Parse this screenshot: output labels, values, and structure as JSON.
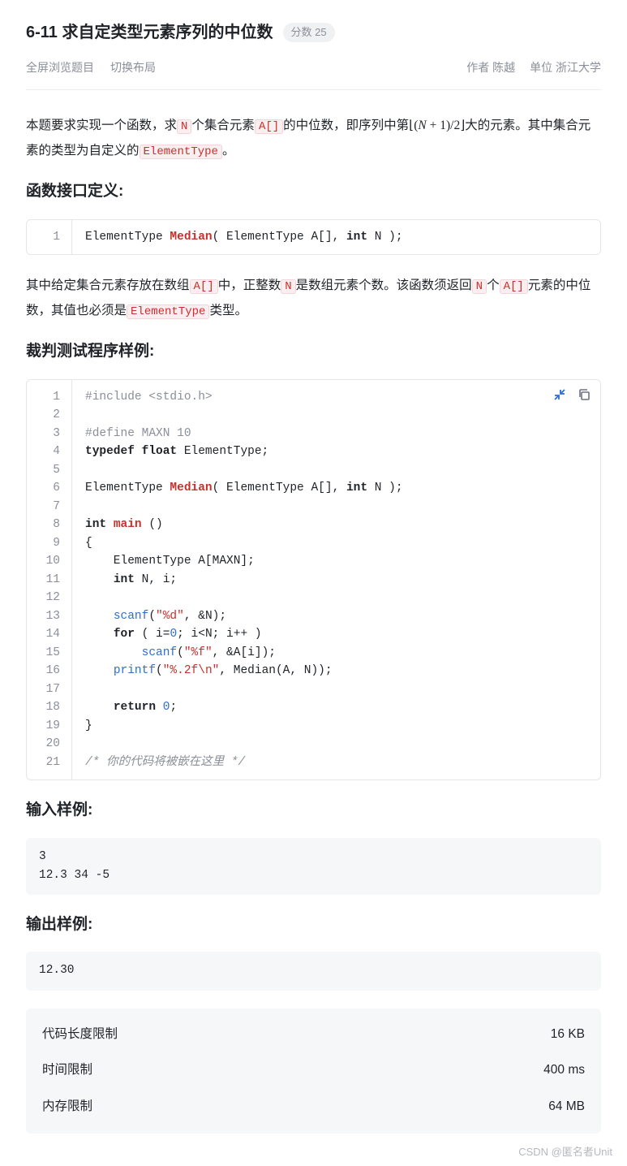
{
  "header": {
    "problem_id": "6-11",
    "title": "求自定类型元素序列的中位数",
    "score_label": "分数 25"
  },
  "subheader": {
    "fullscreen": "全屏浏览题目",
    "switch_layout": "切换布局",
    "author_label": "作者",
    "author": "陈越",
    "org_label": "单位",
    "org": "浙江大学"
  },
  "desc": {
    "p1a": "本题要求实现一个函数，求",
    "N": "N",
    "p1b": "个集合元素",
    "A": "A[]",
    "p1c": "的中位数，即序列中第",
    "math_l": "⌊(",
    "math_n": "N",
    "math_mid": " + 1)/2⌋",
    "p1d": "大的元素。其中集合元素的类型为自定义的",
    "ET": "ElementType",
    "p1e": "。"
  },
  "section_iface": "函数接口定义:",
  "iface_code": {
    "line1": "ElementType Median( ElementType A[], int N );",
    "l1a": "ElementType ",
    "l1fn": "Median",
    "l1b": "( ElementType A[], ",
    "l1kw": "int",
    "l1c": " N );"
  },
  "desc2": {
    "a": "其中给定集合元素存放在数组",
    "A": "A[]",
    "b": "中，正整数",
    "N": "N",
    "c": "是数组元素个数。该函数须返回",
    "N2": "N",
    "d": "个",
    "A2": "A[]",
    "e": "元素的中位数，其值也必须是",
    "ET": "ElementType",
    "f": "类型。"
  },
  "section_sample": "裁判测试程序样例:",
  "sample_code": {
    "lines": 21,
    "l1": "#include <stdio.h>",
    "l3": "#define MAXN 10",
    "l4a": "typedef float",
    "l4b": " ElementType;",
    "l6a": "ElementType ",
    "l6fn": "Median",
    "l6b": "( ElementType A[], ",
    "l6kw": "int",
    "l6c": " N );",
    "l8a": "int ",
    "l8fn": "main",
    "l8b": " ()",
    "l9": "{",
    "l10": "    ElementType A[MAXN];",
    "l11a": "    ",
    "l11kw": "int",
    "l11b": " N, i;",
    "l13a": "    ",
    "l13fn": "scanf",
    "l13b": "(",
    "l13s": "\"%d\"",
    "l13c": ", &N);",
    "l14a": "    ",
    "l14kw": "for",
    "l14b": " ( i=",
    "l14n0": "0",
    "l14c": "; i<N; i++ )",
    "l15a": "        ",
    "l15fn": "scanf",
    "l15b": "(",
    "l15s": "\"%f\"",
    "l15c": ", &A[i]);",
    "l16a": "    ",
    "l16fn": "printf",
    "l16b": "(",
    "l16s": "\"%.2f\\n\"",
    "l16c": ", Median(A, N));",
    "l18a": "    ",
    "l18kw": "return ",
    "l18n": "0",
    "l18b": ";",
    "l19": "}",
    "l21": "/* 你的代码将被嵌在这里 */"
  },
  "section_input": "输入样例:",
  "input_sample": "3\n12.3 34 -5",
  "section_output": "输出样例:",
  "output_sample": "12.30",
  "limits": {
    "code_len_label": "代码长度限制",
    "code_len": "16 KB",
    "time_label": "时间限制",
    "time": "400 ms",
    "mem_label": "内存限制",
    "mem": "64 MB"
  },
  "watermark": "CSDN @匿名者Unit"
}
